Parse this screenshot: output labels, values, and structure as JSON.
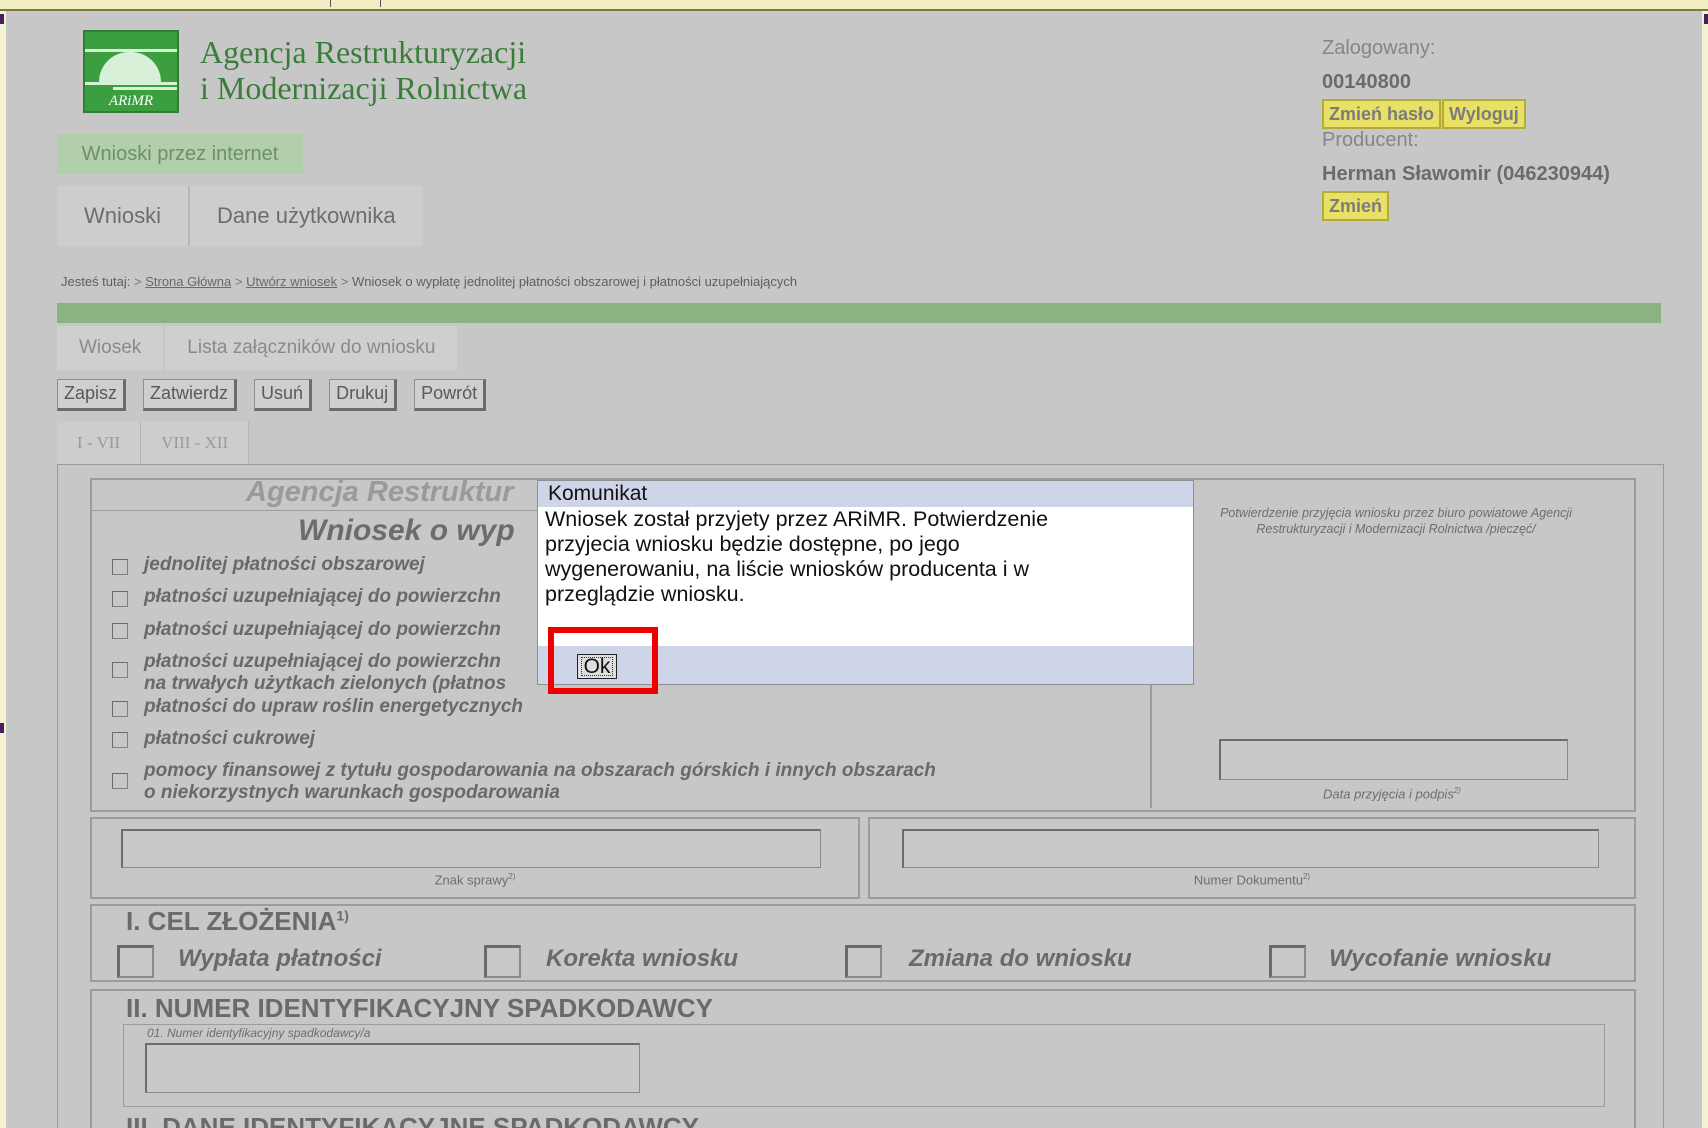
{
  "header": {
    "org_line1": "Agencja Restrukturyzacji",
    "org_line2": "i Modernizacji Rolnictwa",
    "logo_text": "ARiMR",
    "app_badge": "Wnioski przez internet",
    "tabs": [
      {
        "label": "Wnioski"
      },
      {
        "label": "Dane użytkownika"
      }
    ]
  },
  "login": {
    "logged_label": "Zalogowany:",
    "user_id": "00140800",
    "change_password": "Zmień hasło",
    "logout": "Wyloguj",
    "producer_label": "Producent:",
    "producer_name": "Herman Sławomir (046230944)",
    "change_producer": "Zmień"
  },
  "breadcrumb": {
    "prefix": "Jesteś tutaj:",
    "sep": ">",
    "links": [
      "Strona Główna",
      "Utwórz wniosek"
    ],
    "current": "Wniosek o wypłatę jednolitej płatności obszarowej i płatności uzupełniających"
  },
  "subtabs": [
    {
      "label": "Wiosek"
    },
    {
      "label": "Lista załączników do wniosku"
    }
  ],
  "toolbar": {
    "save": "Zapisz",
    "confirm": "Zatwierdz",
    "delete": "Usuń",
    "print": "Drukuj",
    "back": "Powrót"
  },
  "range_tabs": [
    {
      "label": "I - VII"
    },
    {
      "label": "VIII - XII"
    }
  ],
  "form": {
    "agency_header": "Agencja Restruktur",
    "form_title": "Wniosek o wyp",
    "options": [
      "jednolitej płatności obszarowej",
      "płatności uzupełniającej do powierzchn",
      "płatności uzupełniającej do powierzchn",
      "płatności uzupełniającej do powierzchn",
      "na trwałych użytkach zielonych (płatnos",
      "płatności do upraw roślin energetycznych",
      "płatności cukrowej",
      "pomocy finansowej z tytułu gospodarowania na obszarach górskich i innych obszarach",
      "o niekorzystnych warunkach gospodarowania"
    ],
    "confirmation_text": "Potwierdzenie przyjęcia wniosku przez biuro powiatowe Agencji Restrukturyzacji i Modernizacji Rolnictwa /pieczęć/",
    "date_label": "Data przyjęcia i podpis",
    "case_label": "Znak sprawy",
    "doc_label": "Numer Dokumentu",
    "footnote_2": "2)",
    "section1_title": "I. CEL ZŁOŻENIA",
    "section1_sup": "1)",
    "section1_options": [
      "Wypłata płatności",
      "Korekta wniosku",
      "Zmiana do wniosku",
      "Wycofanie wniosku"
    ],
    "section2_title": "II. NUMER IDENTYFIKACYJNY SPADKODAWCY",
    "section2_field_label": "01. Numer identyfikacyjny spadkodawcy/a",
    "section3_title": "III. DANE IDENTYFIKACYJNE SPADKODAWCY"
  },
  "modal": {
    "title": "Komunikat",
    "line1": "Wniosek został przyjety przez ARiMR. Potwierdzenie",
    "line2": "przyjecia wniosku będzie dostępne, po jego",
    "line3": "wygenerowaniu, na liście wniosków producenta i w",
    "line4": "przeglądzie wniosku.",
    "ok": "Ok"
  },
  "colors": {
    "highlight": "#ee0000",
    "green_bar": "#8ab283",
    "button_yellow": "#e9e066"
  }
}
